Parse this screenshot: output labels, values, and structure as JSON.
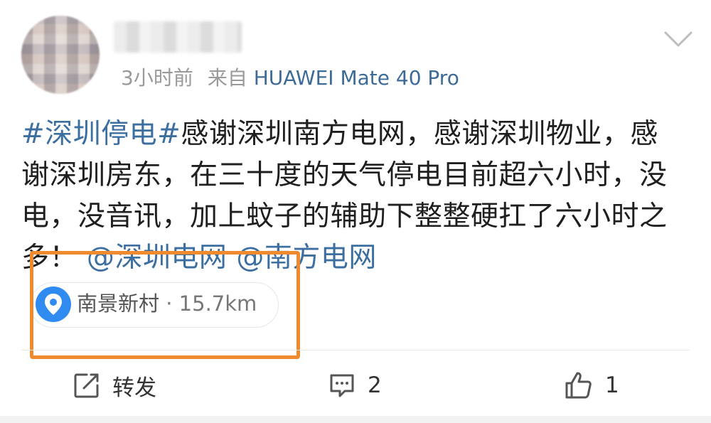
{
  "post": {
    "time": "3小时前",
    "source_prefix": "来自",
    "device": "HUAWEI Mate 40 Pro",
    "content": {
      "line1_topic": "#深圳停电#",
      "line1_rest": "感谢深圳南方电网，感谢深圳物业，感",
      "line2": "谢深圳房东，在三十度的天气停电目前超六小时，没",
      "line3": "电，没音讯，加上蚊子的辅助下整整硬扛了六小时之",
      "line4_prefix": "多！",
      "mention1": "@深圳电网",
      "mention2": "@南方电网"
    },
    "location": {
      "name": "南景新村",
      "separator": "·",
      "distance": "15.7km"
    }
  },
  "actions": {
    "repost_label": "转发",
    "comment_count": "2",
    "like_count": "1"
  },
  "colors": {
    "link": "#3c6fa0",
    "highlight_box": "#f08a2e",
    "location_pin": "#2f8bf0",
    "meta_gray": "#9a9a9a"
  },
  "icons": [
    "location-pin-icon",
    "chevron-down-icon",
    "repost-icon",
    "comment-icon",
    "like-icon"
  ]
}
